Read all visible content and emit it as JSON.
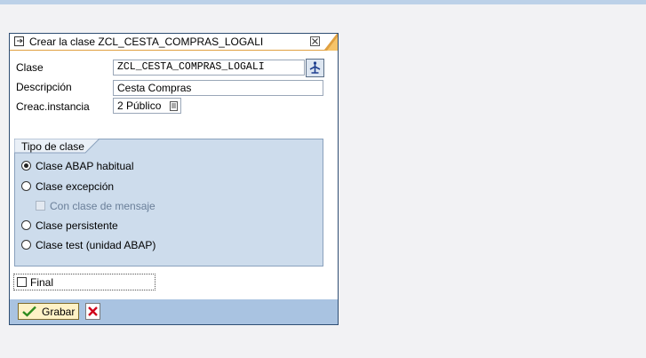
{
  "dialog": {
    "title": "Crear la clase ZCL_CESTA_COMPRAS_LOGALI"
  },
  "fields": {
    "clase_label": "Clase",
    "clase_value": "ZCL_CESTA_COMPRAS_LOGALI",
    "descripcion_label": "Descripción",
    "descripcion_value": "Cesta Compras",
    "creac_label": "Creac.instancia",
    "creac_value": "2 Público"
  },
  "tipo_clase": {
    "title": "Tipo de clase",
    "options": [
      {
        "label": "Clase ABAP habitual",
        "selected": true
      },
      {
        "label": "Clase excepción",
        "selected": false
      },
      {
        "label": "Con clase de mensaje",
        "disabled": true
      },
      {
        "label": "Clase persistente",
        "selected": false
      },
      {
        "label": "Clase test (unidad ABAP)",
        "selected": false
      }
    ]
  },
  "final": {
    "label": "Final",
    "checked": false
  },
  "footer": {
    "save_label": "Grabar",
    "save_icon": "checkmark-icon",
    "cancel_icon": "cancel-x-icon"
  },
  "colors": {
    "accent_line": "#e0a040",
    "group_bg": "#cddcec",
    "footer_bg": "#a9c3e1",
    "save_button_bg": "#fff2c6"
  }
}
